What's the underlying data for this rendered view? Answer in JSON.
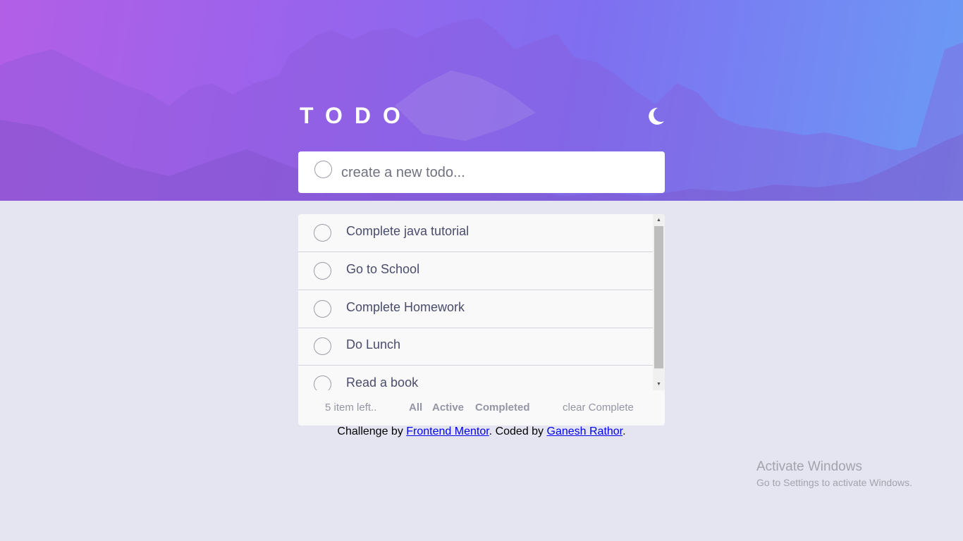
{
  "app": {
    "title": "TODO",
    "theme_icon": "moon-icon"
  },
  "new_todo": {
    "placeholder": "create a new todo..."
  },
  "todos": [
    {
      "label": "Complete java tutorial",
      "completed": false
    },
    {
      "label": "Go to School",
      "completed": false
    },
    {
      "label": "Complete Homework",
      "completed": false
    },
    {
      "label": "Do Lunch",
      "completed": false
    },
    {
      "label": "Read a book",
      "completed": false
    }
  ],
  "footer": {
    "items_left": "5 item left..",
    "filters": [
      "All",
      "Active",
      "Completed"
    ],
    "clear": "clear Complete"
  },
  "credit": {
    "prefix": "Challenge by ",
    "link1": "Frontend Mentor",
    "middle": ". Coded by ",
    "link2": "Ganesh Rathor",
    "suffix": "."
  },
  "watermark": {
    "title": "Activate Windows",
    "subtitle": "Go to Settings to activate Windows."
  },
  "colors": {
    "page_bg": "#e4e5f1",
    "card_bg": "#f9f9f9",
    "text": "#494c6b",
    "muted": "#9495a5",
    "gradient_start": "#b25fe6",
    "gradient_end": "#6a9cf5"
  }
}
